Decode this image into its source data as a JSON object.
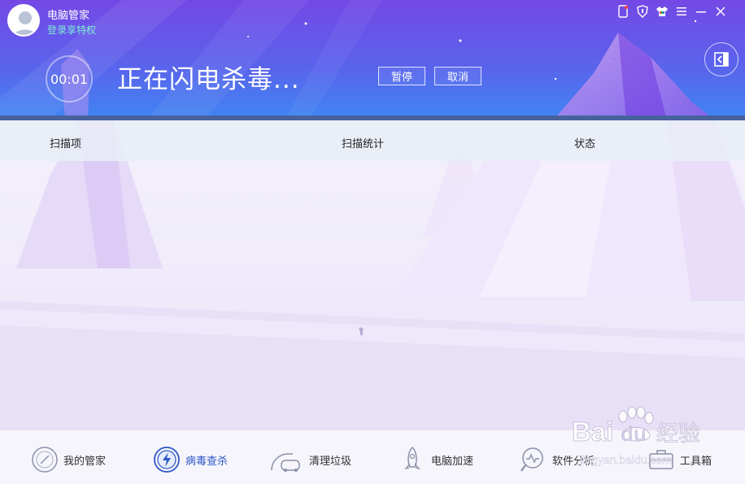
{
  "header": {
    "app_name": "电脑管家",
    "login_text": "登录享特权",
    "timer": "00:01",
    "scan_title": "正在闪电杀毒...",
    "pause_label": "暂停",
    "cancel_label": "取消"
  },
  "window_controls": [
    "phone-icon",
    "shield-icon",
    "shirt-icon",
    "menu-icon",
    "minimize-icon",
    "close-icon"
  ],
  "columns": {
    "scan_item": "扫描项",
    "scan_stats": "扫描统计",
    "status": "状态"
  },
  "nav": {
    "items": [
      {
        "label": "我的管家",
        "icon": "home-icon"
      },
      {
        "label": "病毒查杀",
        "icon": "lightning-shield-icon",
        "active": true
      },
      {
        "label": "清理垃圾",
        "icon": "vacuum-icon"
      },
      {
        "label": "电脑加速",
        "icon": "rocket-icon"
      },
      {
        "label": "软件分析",
        "icon": "magnifier-icon"
      },
      {
        "label": "工具箱",
        "icon": "toolbox-icon"
      }
    ]
  },
  "watermark": {
    "brand": "Bai",
    "brand_tail": "du",
    "suffix": "经验",
    "url": "jingyan.baidu.com"
  },
  "colors": {
    "header_top": "#6b4ee8",
    "header_bottom": "#3f82f0",
    "accent": "#2d57c8",
    "login_text": "#7ef0d6"
  }
}
